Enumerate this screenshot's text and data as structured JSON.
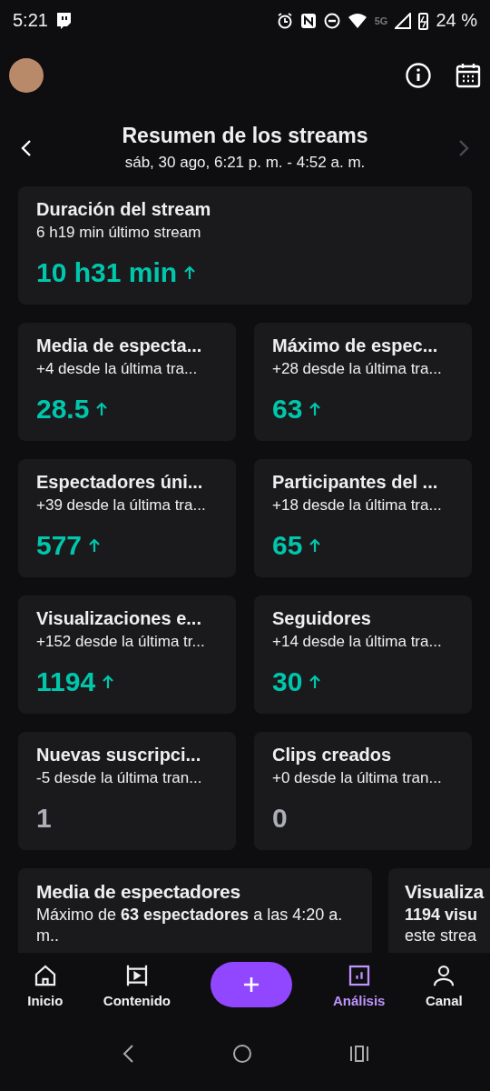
{
  "status_bar": {
    "time": "5:21",
    "network": "5G",
    "battery": "24 %"
  },
  "header": {
    "title": "Resumen de los streams",
    "subtitle": "sáb, 30 ago, 6:21 p. m. - 4:52 a. m.",
    "next_disabled": true
  },
  "summary": {
    "title": "Duración del stream",
    "subtitle": "6 h19 min último stream",
    "value": "10 h31 min",
    "rising": true
  },
  "stats": [
    {
      "title": "Media de especta...",
      "subtitle": "+4 desde la última tra...",
      "value": "28.5",
      "rising": true
    },
    {
      "title": "Máximo de espec...",
      "subtitle": "+28 desde la última tra...",
      "value": "63",
      "rising": true
    },
    {
      "title": "Espectadores úni...",
      "subtitle": "+39 desde la última tra...",
      "value": "577",
      "rising": true
    },
    {
      "title": "Participantes del ...",
      "subtitle": "+18 desde la última tra...",
      "value": "65",
      "rising": true
    },
    {
      "title": "Visualizaciones e...",
      "subtitle": "+152 desde la última tr...",
      "value": "1194",
      "rising": true
    },
    {
      "title": "Seguidores",
      "subtitle": "+14 desde la última tra...",
      "value": "30",
      "rising": true
    },
    {
      "title": "Nuevas suscripci...",
      "subtitle": "-5 desde la última tran...",
      "value": "1",
      "rising": false
    },
    {
      "title": "Clips creados",
      "subtitle": "+0 desde la última tran...",
      "value": "0",
      "rising": false
    }
  ],
  "highlights": [
    {
      "title": "Media de espectadores",
      "description": "Máximo de **63 espectadores** a las 4:20 a. m.."
    },
    {
      "title": "Visualiza",
      "description": "**1194 visu**\neste strea"
    }
  ],
  "nav": [
    {
      "label": "Inicio",
      "kind": "home",
      "selected": false
    },
    {
      "label": "Contenido",
      "kind": "content",
      "selected": false
    },
    {
      "kind": "create",
      "selected": false
    },
    {
      "label": "Análisis",
      "kind": "analytics",
      "selected": true
    },
    {
      "label": "Canal",
      "kind": "channel",
      "selected": false
    }
  ]
}
